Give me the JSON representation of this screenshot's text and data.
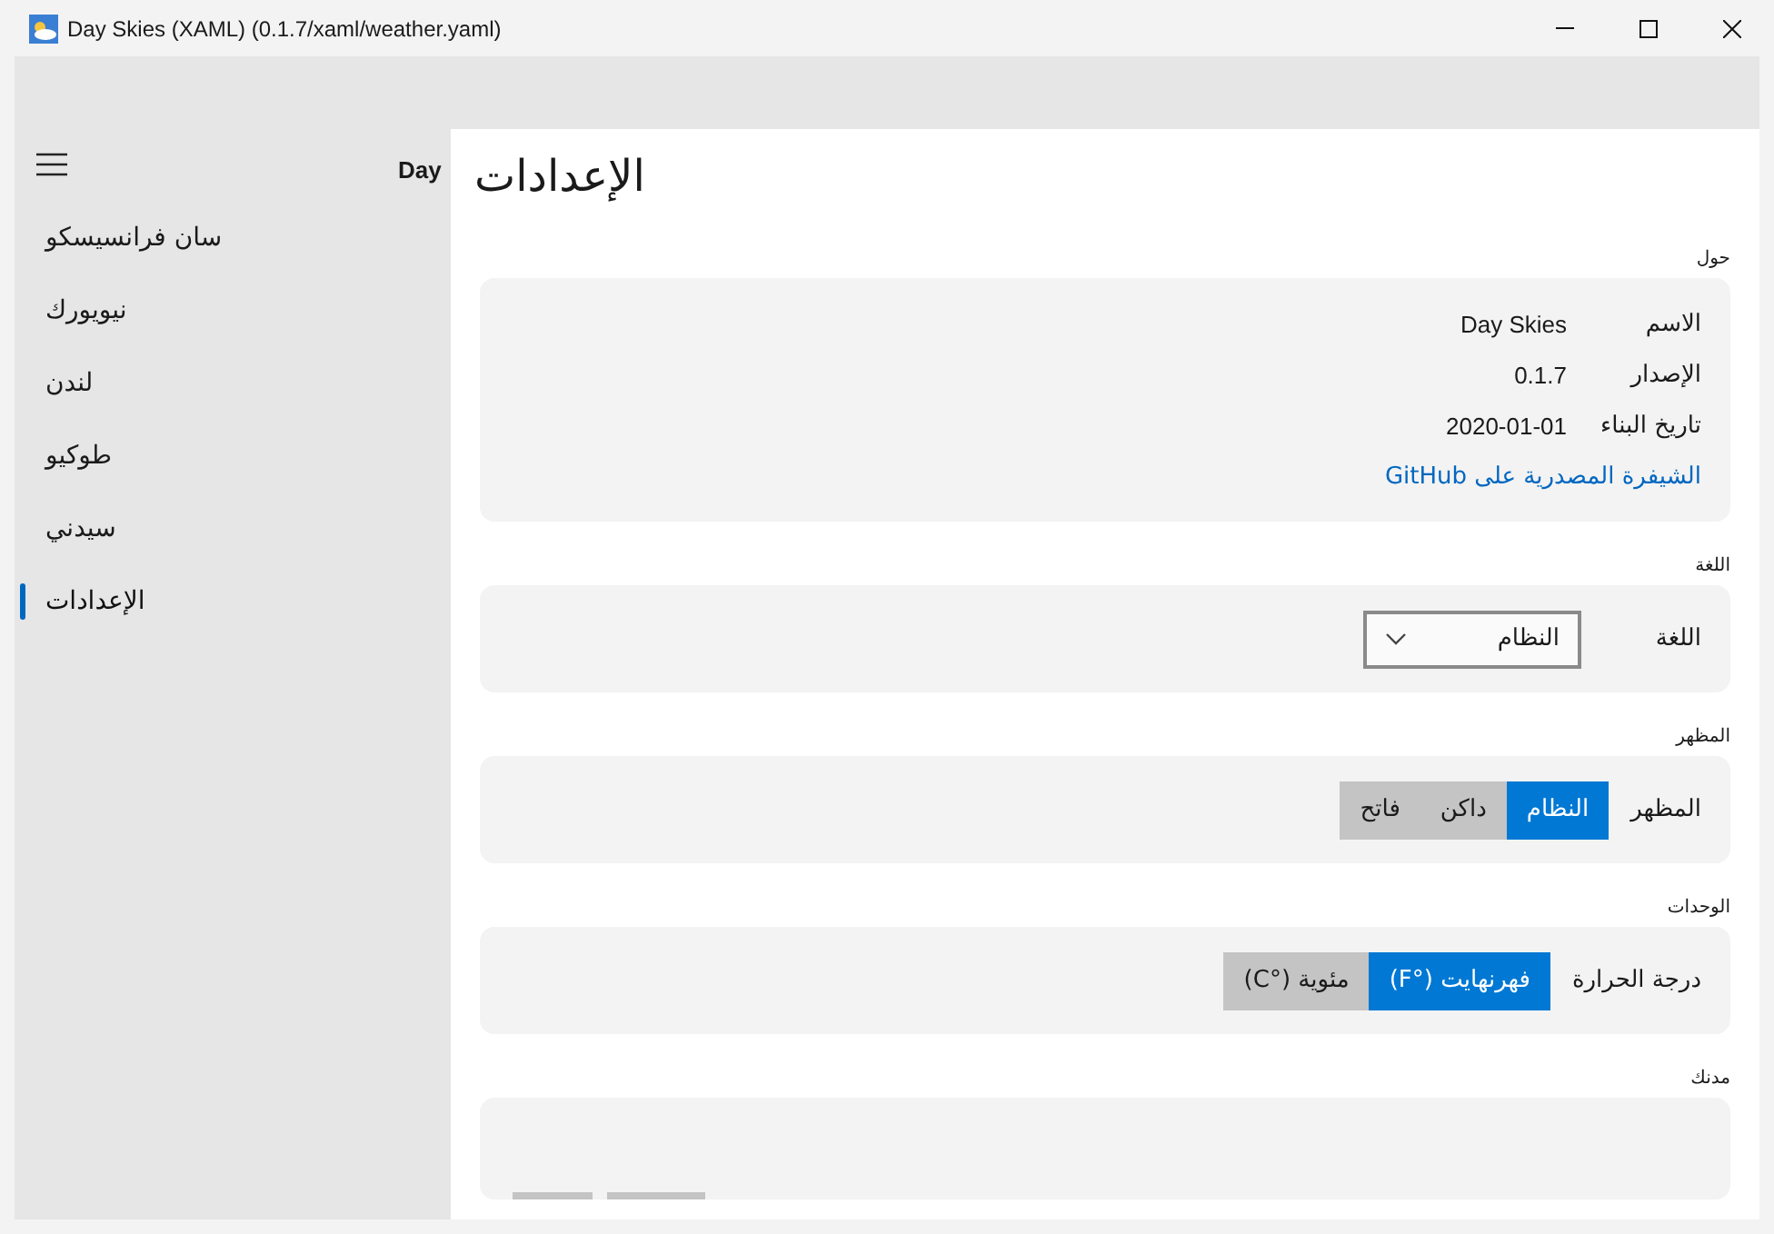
{
  "window": {
    "title": "Day Skies (XAML) (0.1.7/xaml/weather.yaml)"
  },
  "app_title_partial": "Day",
  "sidebar": {
    "items": [
      {
        "label": "سان فرانسيسكو",
        "selected": false
      },
      {
        "label": "نيويورك",
        "selected": false
      },
      {
        "label": "لندن",
        "selected": false
      },
      {
        "label": "طوكيو",
        "selected": false
      },
      {
        "label": "سيدني",
        "selected": false
      },
      {
        "label": "الإعدادات",
        "selected": true
      }
    ]
  },
  "page_title": "الإعدادات",
  "sections": [
    {
      "header": "حول",
      "kind": "about",
      "rows": [
        {
          "label": "الاسم",
          "value": "Day Skies"
        },
        {
          "label": "الإصدار",
          "value": "0.1.7"
        },
        {
          "label": "تاريخ البناء",
          "value": "2020-01-01"
        }
      ],
      "link": "الشيفرة المصدرية على GitHub"
    },
    {
      "header": "اللغة",
      "kind": "dropdown",
      "label": "اللغة",
      "value": "النظام"
    },
    {
      "header": "المظهر",
      "kind": "segmented",
      "label": "المظهر",
      "options": [
        {
          "label": "النظام",
          "selected": true
        },
        {
          "label": "داكن",
          "selected": false
        },
        {
          "label": "فاتح",
          "selected": false
        }
      ]
    },
    {
      "header": "الوحدات",
      "kind": "segmented",
      "label": "درجة الحرارة",
      "options": [
        {
          "label": "فهرنهايت (°F)",
          "selected": true
        },
        {
          "label": "مئوية (°C)",
          "selected": false
        }
      ]
    },
    {
      "header": "مدنك",
      "kind": "cities"
    }
  ]
}
